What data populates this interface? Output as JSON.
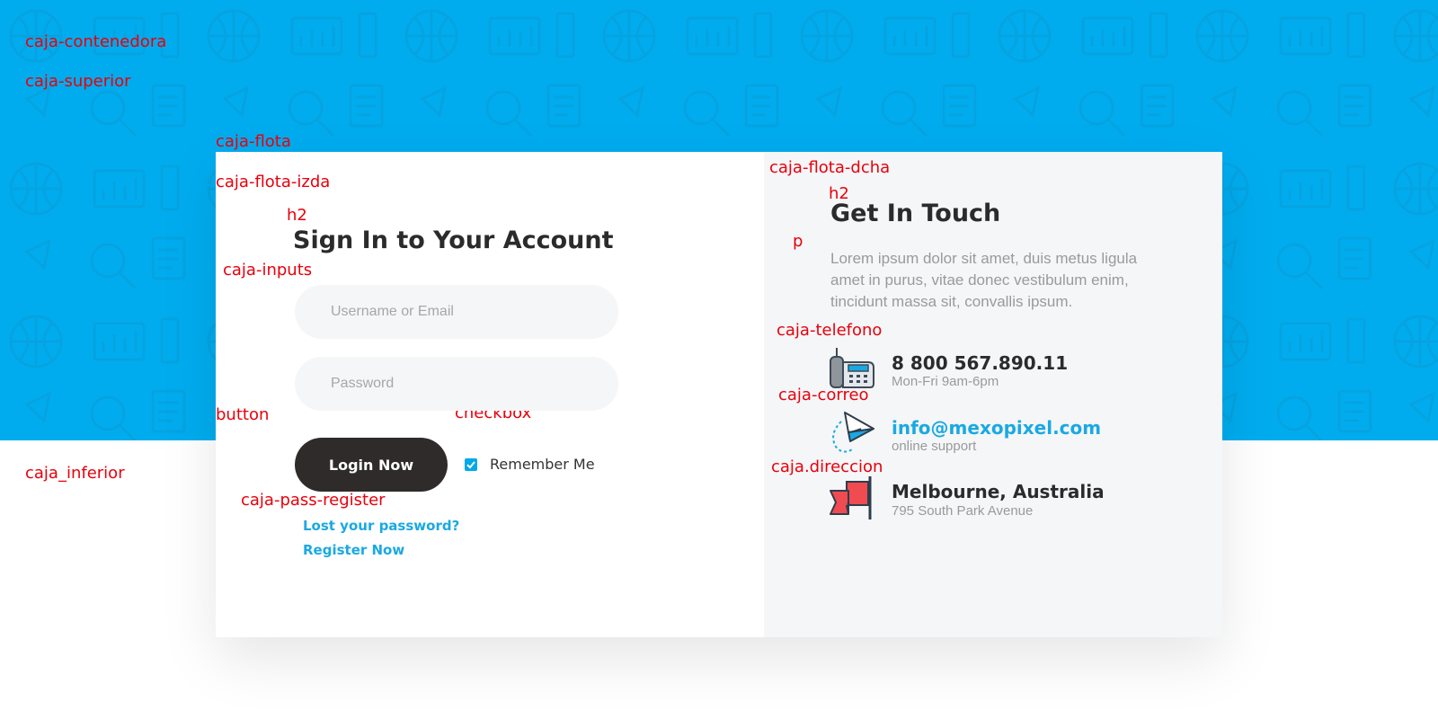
{
  "labels": {
    "container": "caja-contenedora",
    "upper": "caja-superior",
    "float": "caja-flota",
    "float_left": "caja-flota-izda",
    "h2_left": "h2",
    "inputs": "caja-inputs",
    "button": "button",
    "checkbox": "checkbox",
    "pass_register": "caja-pass-register",
    "lower": "caja_inferior",
    "float_right": "caja-flota-dcha",
    "h2_right": "h2",
    "p": "p",
    "phone": "caja-telefono",
    "mail": "caja-correo",
    "address": "caja.direccion"
  },
  "signin": {
    "title": "Sign In to Your Account",
    "username_placeholder": "Username or Email",
    "password_placeholder": "Password",
    "login_label": "Login Now",
    "remember_label": "Remember Me",
    "remember_checked": true,
    "lost_password": "Lost your password?",
    "register": "Register Now"
  },
  "contact": {
    "title": "Get In Touch",
    "intro": "Lorem ipsum dolor sit amet, duis metus ligula amet in purus, vitae donec vestibulum enim, tincidunt massa sit, convallis ipsum.",
    "phone": {
      "icon": "telephone-icon",
      "main": "8 800 567.890.11",
      "sub": "Mon-Fri 9am-6pm"
    },
    "email": {
      "icon": "paper-plane-icon",
      "main": "info@mexopixel.com",
      "sub": "online support"
    },
    "address": {
      "icon": "flag-icon",
      "main": "Melbourne, Australia",
      "sub": "795 South Park Avenue"
    }
  },
  "colors": {
    "band": "#00acee",
    "accent": "#1aa9e3",
    "button": "#2f2b2b",
    "label": "#e8000b",
    "panel": "#f5f6f8"
  }
}
